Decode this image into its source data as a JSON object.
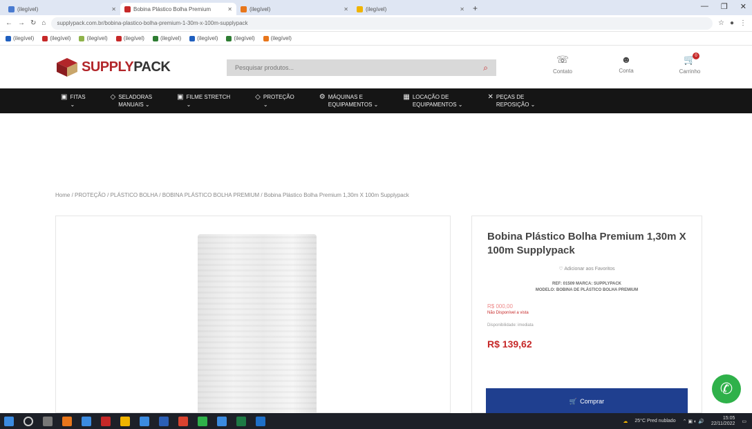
{
  "browser": {
    "tabs": [
      {
        "label": "(ilegível)",
        "color": "#4a7bd0",
        "active": false
      },
      {
        "label": "Bobina Plástico Bolha Premium",
        "color": "#c62828",
        "active": true
      },
      {
        "label": "(ilegível)",
        "color": "#e8761b",
        "active": false
      },
      {
        "label": "(ilegível)",
        "color": "#f0b400",
        "active": false
      }
    ],
    "new_tab": "+",
    "url": "supplypack.com.br/bobina-plastico-bolha-premium-1-30m-x-100m-supplypack",
    "bookmarks": [
      {
        "label": "(ilegível)",
        "color": "#1f5fbf"
      },
      {
        "label": "(ilegível)",
        "color": "#c62828"
      },
      {
        "label": "(ilegível)",
        "color": "#8fb34a"
      },
      {
        "label": "(ilegível)",
        "color": "#c62828"
      },
      {
        "label": "(ilegível)",
        "color": "#2e7d32"
      },
      {
        "label": "(ilegível)",
        "color": "#1f5fbf"
      },
      {
        "label": "(ilegível)",
        "color": "#2e7d32"
      },
      {
        "label": "(ilegível)",
        "color": "#e8761b"
      }
    ]
  },
  "header": {
    "logo_prefix": "SUPPLY",
    "logo_suffix": "PACK",
    "search_placeholder": "Pesquisar produtos...",
    "icons": [
      {
        "label": "Contato",
        "glyph": "☏"
      },
      {
        "label": "Conta",
        "glyph": "☻"
      },
      {
        "label": "Carrinho",
        "glyph": "🛒",
        "badge": "0"
      }
    ]
  },
  "nav": [
    {
      "icon": "▣",
      "line1": "Fitas",
      "line2": "⌄"
    },
    {
      "icon": "◇",
      "line1": "Seladoras",
      "line2": "Manuais ⌄"
    },
    {
      "icon": "▣",
      "line1": "Filme Stretch",
      "line2": "⌄"
    },
    {
      "icon": "◇",
      "line1": "Proteção",
      "line2": "⌄"
    },
    {
      "icon": "⚙",
      "line1": "Máquinas e",
      "line2": "Equipamentos ⌄"
    },
    {
      "icon": "▦",
      "line1": "Locação de",
      "line2": "Equipamentos ⌄"
    },
    {
      "icon": "✕",
      "line1": "Peças de",
      "line2": "Reposição ⌄"
    }
  ],
  "breadcrumb": "Home / PROTEÇÃO / PLÁSTICO BOLHA / BOBINA PLÁSTICO BOLHA PREMIUM / Bobina Plástico Bolha Premium 1,30m X 100m Supplypack",
  "product": {
    "title": "Bobina Plástico Bolha Premium 1,30m X 100m Supplypack",
    "favorites": "♡ Adicionar aos Favoritos",
    "ref": "REF: 01509    MARCA: SUPPLYPACK",
    "model": "MODELO: BOBINA DE PLÁSTICO BOLHA PREMIUM",
    "old_price": "R$ 000,00",
    "unavailable": "Não Disponível a vista",
    "availability": "Disponibilidade: imediata",
    "price": "R$ 139,62",
    "buy_label": "Comprar",
    "buy_icon": "🛒"
  },
  "whatsapp_glyph": "✆",
  "taskbar": {
    "weather": "25°C  Pred nublado",
    "time": "15:05",
    "date": "22/11/2022"
  }
}
